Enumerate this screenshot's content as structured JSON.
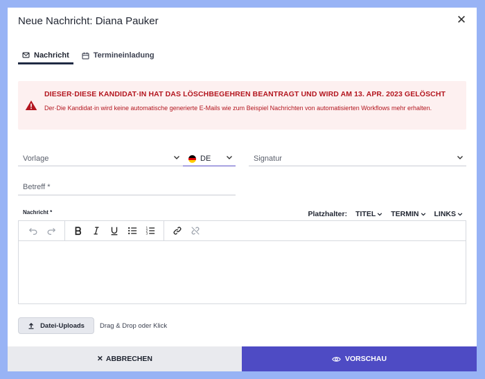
{
  "dialog": {
    "title": "Neue Nachricht: Diana Pauker",
    "close_glyph": "✕"
  },
  "tabs": [
    {
      "label": "Nachricht",
      "icon": "envelope-icon",
      "active": true
    },
    {
      "label": "Termineinladung",
      "icon": "calendar-icon",
      "active": false
    }
  ],
  "alert": {
    "title": "DIESER·DIESE KANDIDAT·IN HAT DAS LÖSCHBEGEHREN BEANTRAGT UND WIRD AM 13. APR. 2023 GELÖSCHT",
    "text": "Der·Die Kandidat·in wird keine automatische generierte E-Mails wie zum Beispiel Nachrichten von automatisierten Workflows mehr erhalten.",
    "icon": "warning-icon",
    "color": "#b3161f"
  },
  "form": {
    "vorlage_label": "Vorlage",
    "language_value": "DE",
    "signatur_label": "Signatur",
    "betreff_label": "Betreff *",
    "nachricht_label": "Nachricht *"
  },
  "placeholders": {
    "label": "Platzhalter:",
    "items": [
      "TITEL",
      "TERMIN",
      "LINKS"
    ]
  },
  "upload": {
    "button_label": "Datei-Uploads",
    "hint": "Drag & Drop oder Klick"
  },
  "footer": {
    "cancel_label": "ABBRECHEN",
    "cancel_glyph": "✕",
    "preview_label": "VORSCHAU",
    "accent_color": "#4e4bc4"
  }
}
